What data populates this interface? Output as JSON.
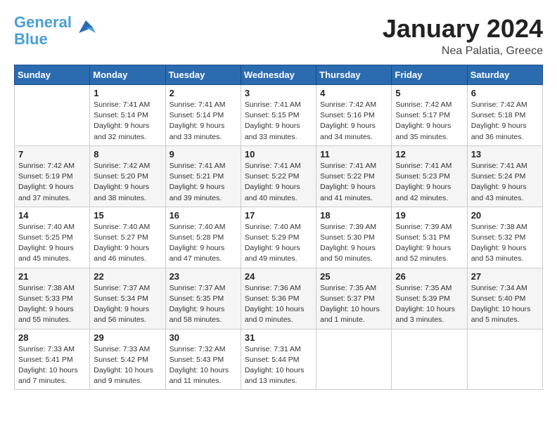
{
  "header": {
    "logo_line1": "General",
    "logo_line2": "Blue",
    "month": "January 2024",
    "location": "Nea Palatia, Greece"
  },
  "days_of_week": [
    "Sunday",
    "Monday",
    "Tuesday",
    "Wednesday",
    "Thursday",
    "Friday",
    "Saturday"
  ],
  "weeks": [
    [
      {
        "day": "",
        "info": ""
      },
      {
        "day": "1",
        "info": "Sunrise: 7:41 AM\nSunset: 5:14 PM\nDaylight: 9 hours\nand 32 minutes."
      },
      {
        "day": "2",
        "info": "Sunrise: 7:41 AM\nSunset: 5:14 PM\nDaylight: 9 hours\nand 33 minutes."
      },
      {
        "day": "3",
        "info": "Sunrise: 7:41 AM\nSunset: 5:15 PM\nDaylight: 9 hours\nand 33 minutes."
      },
      {
        "day": "4",
        "info": "Sunrise: 7:42 AM\nSunset: 5:16 PM\nDaylight: 9 hours\nand 34 minutes."
      },
      {
        "day": "5",
        "info": "Sunrise: 7:42 AM\nSunset: 5:17 PM\nDaylight: 9 hours\nand 35 minutes."
      },
      {
        "day": "6",
        "info": "Sunrise: 7:42 AM\nSunset: 5:18 PM\nDaylight: 9 hours\nand 36 minutes."
      }
    ],
    [
      {
        "day": "7",
        "info": "Sunrise: 7:42 AM\nSunset: 5:19 PM\nDaylight: 9 hours\nand 37 minutes."
      },
      {
        "day": "8",
        "info": "Sunrise: 7:42 AM\nSunset: 5:20 PM\nDaylight: 9 hours\nand 38 minutes."
      },
      {
        "day": "9",
        "info": "Sunrise: 7:41 AM\nSunset: 5:21 PM\nDaylight: 9 hours\nand 39 minutes."
      },
      {
        "day": "10",
        "info": "Sunrise: 7:41 AM\nSunset: 5:22 PM\nDaylight: 9 hours\nand 40 minutes."
      },
      {
        "day": "11",
        "info": "Sunrise: 7:41 AM\nSunset: 5:22 PM\nDaylight: 9 hours\nand 41 minutes."
      },
      {
        "day": "12",
        "info": "Sunrise: 7:41 AM\nSunset: 5:23 PM\nDaylight: 9 hours\nand 42 minutes."
      },
      {
        "day": "13",
        "info": "Sunrise: 7:41 AM\nSunset: 5:24 PM\nDaylight: 9 hours\nand 43 minutes."
      }
    ],
    [
      {
        "day": "14",
        "info": "Sunrise: 7:40 AM\nSunset: 5:25 PM\nDaylight: 9 hours\nand 45 minutes."
      },
      {
        "day": "15",
        "info": "Sunrise: 7:40 AM\nSunset: 5:27 PM\nDaylight: 9 hours\nand 46 minutes."
      },
      {
        "day": "16",
        "info": "Sunrise: 7:40 AM\nSunset: 5:28 PM\nDaylight: 9 hours\nand 47 minutes."
      },
      {
        "day": "17",
        "info": "Sunrise: 7:40 AM\nSunset: 5:29 PM\nDaylight: 9 hours\nand 49 minutes."
      },
      {
        "day": "18",
        "info": "Sunrise: 7:39 AM\nSunset: 5:30 PM\nDaylight: 9 hours\nand 50 minutes."
      },
      {
        "day": "19",
        "info": "Sunrise: 7:39 AM\nSunset: 5:31 PM\nDaylight: 9 hours\nand 52 minutes."
      },
      {
        "day": "20",
        "info": "Sunrise: 7:38 AM\nSunset: 5:32 PM\nDaylight: 9 hours\nand 53 minutes."
      }
    ],
    [
      {
        "day": "21",
        "info": "Sunrise: 7:38 AM\nSunset: 5:33 PM\nDaylight: 9 hours\nand 55 minutes."
      },
      {
        "day": "22",
        "info": "Sunrise: 7:37 AM\nSunset: 5:34 PM\nDaylight: 9 hours\nand 56 minutes."
      },
      {
        "day": "23",
        "info": "Sunrise: 7:37 AM\nSunset: 5:35 PM\nDaylight: 9 hours\nand 58 minutes."
      },
      {
        "day": "24",
        "info": "Sunrise: 7:36 AM\nSunset: 5:36 PM\nDaylight: 10 hours\nand 0 minutes."
      },
      {
        "day": "25",
        "info": "Sunrise: 7:35 AM\nSunset: 5:37 PM\nDaylight: 10 hours\nand 1 minute."
      },
      {
        "day": "26",
        "info": "Sunrise: 7:35 AM\nSunset: 5:39 PM\nDaylight: 10 hours\nand 3 minutes."
      },
      {
        "day": "27",
        "info": "Sunrise: 7:34 AM\nSunset: 5:40 PM\nDaylight: 10 hours\nand 5 minutes."
      }
    ],
    [
      {
        "day": "28",
        "info": "Sunrise: 7:33 AM\nSunset: 5:41 PM\nDaylight: 10 hours\nand 7 minutes."
      },
      {
        "day": "29",
        "info": "Sunrise: 7:33 AM\nSunset: 5:42 PM\nDaylight: 10 hours\nand 9 minutes."
      },
      {
        "day": "30",
        "info": "Sunrise: 7:32 AM\nSunset: 5:43 PM\nDaylight: 10 hours\nand 11 minutes."
      },
      {
        "day": "31",
        "info": "Sunrise: 7:31 AM\nSunset: 5:44 PM\nDaylight: 10 hours\nand 13 minutes."
      },
      {
        "day": "",
        "info": ""
      },
      {
        "day": "",
        "info": ""
      },
      {
        "day": "",
        "info": ""
      }
    ]
  ]
}
